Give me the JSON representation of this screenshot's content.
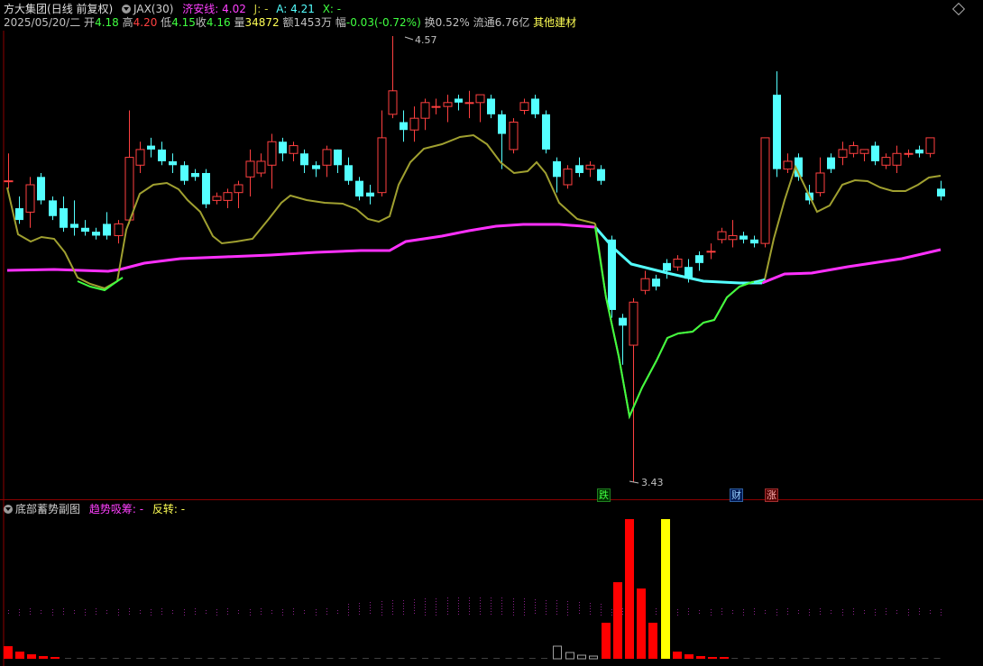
{
  "header": {
    "stock_name": "方大集团",
    "period": "(日线 前复权)",
    "indicator1_name": "JAX(30)",
    "ind_label_jian": "济安线:",
    "ind_val_jian": "4.02",
    "ind_label_j": "J:",
    "ind_val_j": "-",
    "ind_label_a": "A:",
    "ind_val_a": "4.21",
    "ind_label_x": "X:",
    "ind_val_x": "-"
  },
  "info": {
    "date": "2025/05/20/二",
    "open_label": "开",
    "open": "4.18",
    "high_label": "高",
    "high": "4.20",
    "low_label": "低",
    "low": "4.15",
    "close_label": "收",
    "close": "4.16",
    "volume_label": "量",
    "volume": "34872",
    "amount_label": "额",
    "amount": "1453万",
    "change_label": "幅",
    "change": "-0.03(-0.72%)",
    "turnover_label": "换",
    "turnover": "0.52%",
    "float_label": "流通",
    "float": "6.76亿",
    "industry": "其他建材"
  },
  "main_chart": {
    "max_price_label": "4.57",
    "min_price_label": "3.43",
    "tag_die": "跌",
    "tag_cai": "财",
    "tag_zhang": "涨"
  },
  "sub_chart": {
    "title": "底部蓄势副图",
    "label_trend": "趋势吸筹:",
    "val_trend": "-",
    "label_reverse": "反转:",
    "val_reverse": "-"
  },
  "colors": {
    "up": "#ff4040",
    "down": "#54ffff",
    "ma_pink": "#ff30ff",
    "line_olive": "#a0a030",
    "line_green": "#40ff40",
    "line_cyan": "#54ffff",
    "bar_red": "#ff0000",
    "bar_yellow": "#ffff00",
    "industry": "#ffff54"
  }
}
